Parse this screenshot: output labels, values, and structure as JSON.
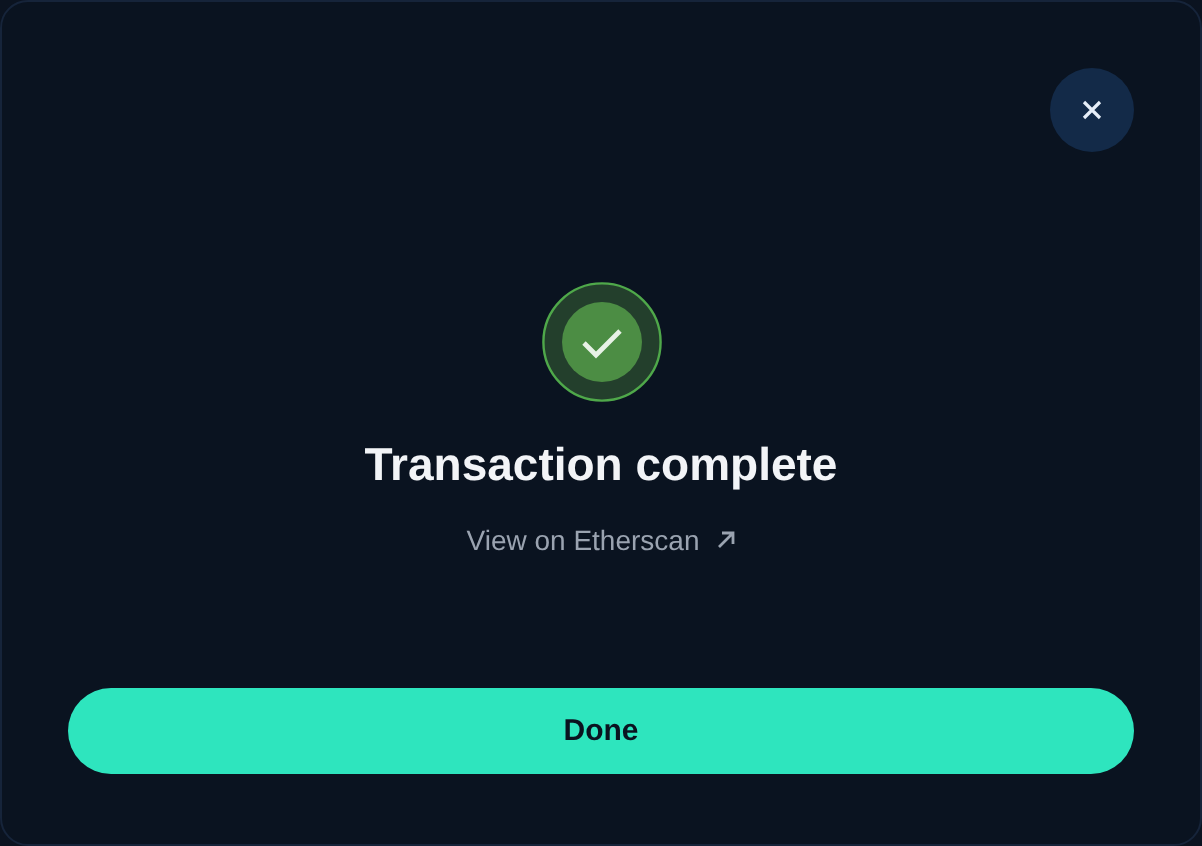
{
  "dialog": {
    "title": "Transaction complete",
    "link": "View on Etherscan",
    "button": "Done"
  }
}
